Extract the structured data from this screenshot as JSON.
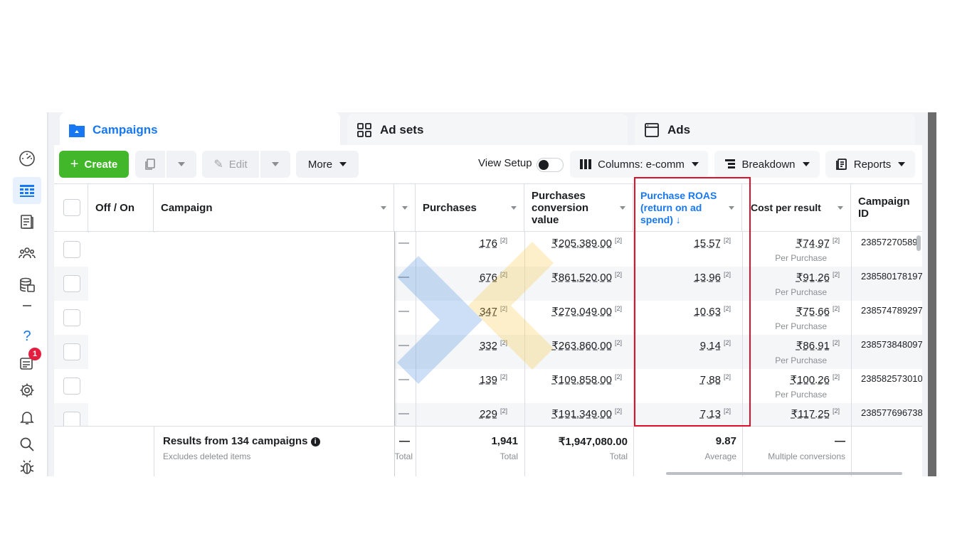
{
  "rail": {
    "notification_count": "1",
    "icons": [
      "dashboard-icon",
      "campaigns-grid-icon",
      "notebook-icon",
      "audiences-icon",
      "database-icon",
      "dash-icon",
      "help-icon",
      "notifications-icon",
      "settings-icon",
      "alerts-bell-icon",
      "search-icon",
      "bug-icon"
    ]
  },
  "tabs": [
    {
      "label": "Campaigns",
      "icon": "folder-icon"
    },
    {
      "label": "Ad sets",
      "icon": "grid-icon"
    },
    {
      "label": "Ads",
      "icon": "ad-window-icon"
    }
  ],
  "toolbar": {
    "create_label": "Create",
    "edit_label": "Edit",
    "more_label": "More",
    "view_setup_label": "View Setup",
    "columns_label": "Columns: e-comm",
    "breakdown_label": "Breakdown",
    "reports_label": "Reports"
  },
  "columns": {
    "off_on": "Off / On",
    "campaign": "Campaign",
    "purchases": "Purchases",
    "purchases_value": "Purchases conversion value",
    "roas": "Purchase ROAS (return on ad spend) ↓",
    "cost_per_result": "Cost per result",
    "campaign_id": "Campaign ID"
  },
  "marker": "[2]",
  "rows": [
    {
      "dash": "—",
      "purchases": "176",
      "value": "₹205,389.00",
      "roas": "15.57",
      "cost": "₹74.97",
      "cost_sub": "Per Purchase",
      "id": "23857270589"
    },
    {
      "dash": "—",
      "purchases": "676",
      "value": "₹861,520.00",
      "roas": "13.96",
      "cost": "₹91.26",
      "cost_sub": "Per Purchase",
      "id": "238580178197"
    },
    {
      "dash": "—",
      "purchases": "347",
      "value": "₹279,049.00",
      "roas": "10.63",
      "cost": "₹75.66",
      "cost_sub": "Per Purchase",
      "id": "238574789297"
    },
    {
      "dash": "—",
      "purchases": "332",
      "value": "₹263,860.00",
      "roas": "9.14",
      "cost": "₹86.91",
      "cost_sub": "Per Purchase",
      "id": "238573848097"
    },
    {
      "dash": "—",
      "purchases": "139",
      "value": "₹109,858.00",
      "roas": "7.88",
      "cost": "₹100.26",
      "cost_sub": "Per Purchase",
      "id": "238582573010"
    },
    {
      "dash": "—",
      "purchases": "229",
      "value": "₹191,349.00",
      "roas": "7.13",
      "cost": "₹117.25",
      "cost_sub": "",
      "id": "238577696738"
    }
  ],
  "footer": {
    "results": "Results from 134 campaigns",
    "excludes": "Excludes deleted items",
    "dash": "—",
    "dash_sub": "Total",
    "purchases_total": "1,941",
    "purchases_sub": "Total",
    "value_total": "₹1,947,080.00",
    "value_sub": "Total",
    "roas_avg": "9.87",
    "roas_sub": "Average",
    "cost_dash": "—",
    "cost_sub": "Multiple conversions"
  },
  "colors": {
    "accent": "#1877f2",
    "create": "#42b72a",
    "highlight": "#e0102a",
    "badge": "#e41e3f"
  }
}
